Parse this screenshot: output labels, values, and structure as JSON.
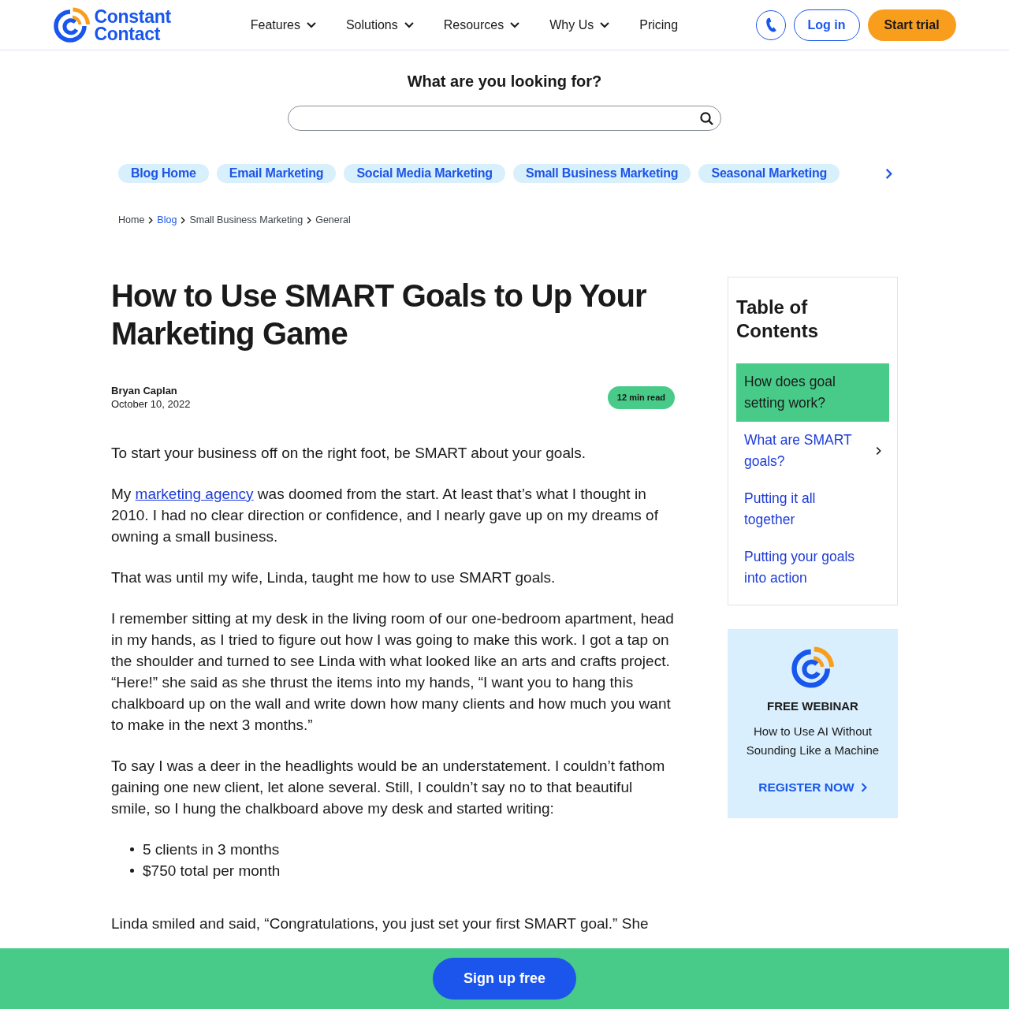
{
  "header": {
    "logo": {
      "lines": [
        "Constant",
        "Contact"
      ]
    },
    "nav": [
      {
        "label": "Features",
        "dropdown": true
      },
      {
        "label": "Solutions",
        "dropdown": true
      },
      {
        "label": "Resources",
        "dropdown": true
      },
      {
        "label": "Why Us",
        "dropdown": true
      },
      {
        "label": "Pricing",
        "dropdown": false
      }
    ],
    "login": "Log in",
    "start_trial": "Start trial"
  },
  "search": {
    "heading": "What are you looking for?"
  },
  "category_tags": [
    {
      "label": "Blog Home"
    },
    {
      "label": "Email Marketing"
    },
    {
      "label": "Social Media Marketing"
    },
    {
      "label": "Small Business Marketing"
    },
    {
      "label": "Seasonal Marketing"
    }
  ],
  "breadcrumb": [
    {
      "label": "Home",
      "link": false
    },
    {
      "label": "Blog",
      "link": true
    },
    {
      "label": "Small Business Marketing",
      "link": false
    },
    {
      "label": "General",
      "link": false
    }
  ],
  "article": {
    "title": "How to Use SMART Goals to Up Your Marketing Game",
    "author": "Bryan Caplan",
    "date": "October 10, 2022",
    "read_time": "12 min read",
    "body": [
      {
        "kind": "paragraph",
        "parts": [
          {
            "text": "To start your business off on the right foot, be SMART about your goals.",
            "link": false
          }
        ]
      },
      {
        "kind": "paragraph",
        "parts": [
          {
            "text": "My ",
            "link": false
          },
          {
            "text": "marketing agency",
            "link": true
          },
          {
            "text": " was doomed from the start. At least that’s what I thought in 2010. I had no clear direction or confidence, and I nearly gave up on my dreams of owning a small business.",
            "link": false
          }
        ]
      },
      {
        "kind": "paragraph",
        "parts": [
          {
            "text": "That was until my wife, Linda, taught me how to use SMART goals.",
            "link": false
          }
        ]
      },
      {
        "kind": "paragraph",
        "parts": [
          {
            "text": "I remember sitting at my desk in the living room of our one-bedroom apartment, head in my hands, as I tried to figure out how I was going to make this work. I got a tap on the shoulder and turned to see Linda with what looked like an arts and crafts project. “Here!” she said as she thrust the items into my hands, “I want you to hang this chalkboard up on the wall and write down how many clients and how much you want to make in the next 3 months.”",
            "link": false
          }
        ]
      },
      {
        "kind": "paragraph",
        "parts": [
          {
            "text": "To say I was a deer in the headlights would be an understatement. I couldn’t fathom gaining one new client, let alone several. Still, I couldn’t say no to that beautiful smile, so I hung the chalkboard above my desk and started writing:",
            "link": false
          }
        ]
      },
      {
        "kind": "list",
        "items": [
          "5 clients in 3 months",
          "$750 total per month"
        ]
      },
      {
        "kind": "paragraph",
        "parts": [
          {
            "text": "Linda smiled and said, “Congratulations, you just set your first SMART goal.” She",
            "link": false
          }
        ]
      }
    ]
  },
  "toc": {
    "title": "Table of Contents",
    "items": [
      {
        "label": "How does goal setting work?",
        "selected": true,
        "expandable": false
      },
      {
        "label": "What are SMART goals?",
        "selected": false,
        "expandable": true
      },
      {
        "label": "Putting it all together",
        "selected": false,
        "expandable": false
      },
      {
        "label": "Putting your goals into action",
        "selected": false,
        "expandable": false
      }
    ]
  },
  "webinar": {
    "label": "FREE WEBINAR",
    "title": "How to Use AI Without Sounding Like a Machine",
    "cta": "REGISTER NOW"
  },
  "signup_bar": {
    "button": "Sign up free"
  }
}
